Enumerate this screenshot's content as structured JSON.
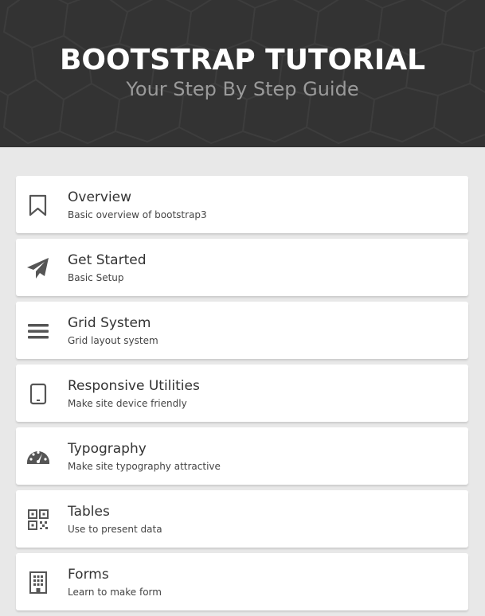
{
  "header": {
    "title": "BOOTSTRAP TUTORIAL",
    "subtitle": "Your Step By Step Guide"
  },
  "colors": {
    "header_bg": "#333333",
    "page_bg": "#e8e8e8",
    "card_bg": "#ffffff",
    "icon": "#555555"
  },
  "items": [
    {
      "title": "Overview",
      "description": "Basic overview of bootstrap3",
      "icon": "bookmark-icon"
    },
    {
      "title": "Get Started",
      "description": "Basic Setup",
      "icon": "paper-plane-icon"
    },
    {
      "title": "Grid System",
      "description": "Grid layout system",
      "icon": "bars-icon"
    },
    {
      "title": "Responsive Utilities",
      "description": "Make site device friendly",
      "icon": "tablet-icon"
    },
    {
      "title": "Typography",
      "description": "Make site typography attractive",
      "icon": "dashboard-icon"
    },
    {
      "title": "Tables",
      "description": "Use to present data",
      "icon": "qrcode-icon"
    },
    {
      "title": "Forms",
      "description": "Learn to make form",
      "icon": "building-icon"
    }
  ]
}
